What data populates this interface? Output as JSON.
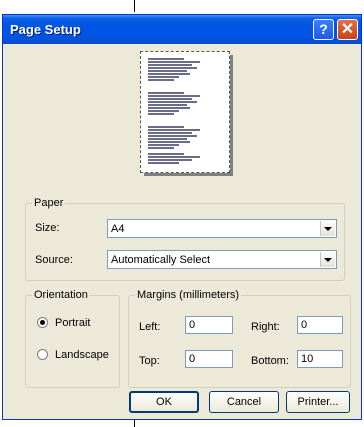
{
  "window": {
    "title": "Page Setup"
  },
  "titlebar": {
    "help_label": "?",
    "close_label": "✕"
  },
  "paper": {
    "group_label": "Paper",
    "size_label": "Size:",
    "size_value": "A4",
    "source_label": "Source:",
    "source_value": "Automatically Select"
  },
  "orientation": {
    "group_label": "Orientation",
    "options": [
      {
        "label": "Portrait",
        "selected": true
      },
      {
        "label": "Landscape",
        "selected": false
      }
    ]
  },
  "margins": {
    "group_label": "Margins (millimeters)",
    "left_label": "Left:",
    "left_value": "0",
    "right_label": "Right:",
    "right_value": "0",
    "top_label": "Top:",
    "top_value": "0",
    "bottom_label": "Bottom:",
    "bottom_value": "10"
  },
  "buttons": {
    "ok": "OK",
    "cancel": "Cancel",
    "printer": "Printer..."
  }
}
